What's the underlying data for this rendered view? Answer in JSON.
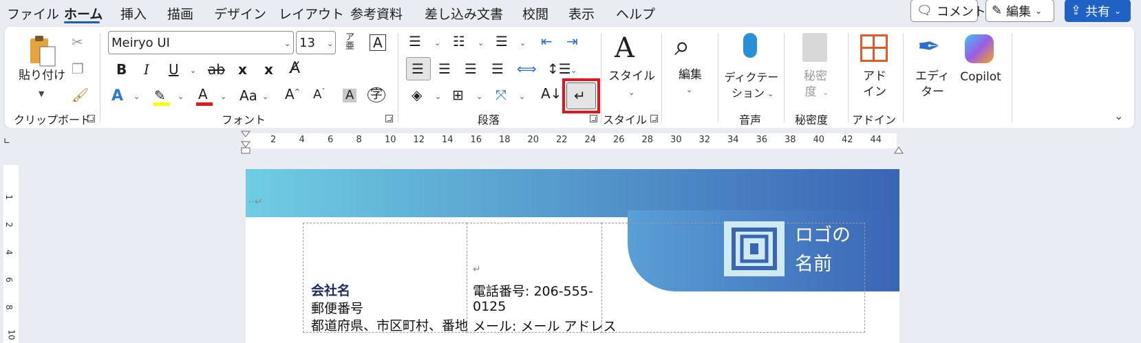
{
  "menu": {
    "file": "ファイル",
    "home": "ホーム",
    "insert": "挿入",
    "draw": "描画",
    "design": "デザイン",
    "layout": "レイアウト",
    "references": "参考資料",
    "mailings": "差し込み文書",
    "review": "校閲",
    "view": "表示",
    "help": "ヘルプ"
  },
  "top_buttons": {
    "comment": "コメント",
    "edit": "編集",
    "share": "共有"
  },
  "ribbon": {
    "clipboard": {
      "paste": "貼り付け",
      "group": "クリップボード"
    },
    "font": {
      "name": "Meiryo UI",
      "size": "13",
      "group": "フォント",
      "bold": "B",
      "italic": "I",
      "underline": "U",
      "strike": "ab",
      "sub": "x",
      "sup": "x",
      "case": "Aa"
    },
    "paragraph": {
      "group": "段落"
    },
    "styles": {
      "label": "スタイル",
      "group": "スタイル"
    },
    "editing": {
      "label": "編集"
    },
    "voice": {
      "label1": "ディクテー",
      "label2": "ション",
      "group": "音声"
    },
    "sensitivity": {
      "label1": "秘密",
      "label2": "度",
      "group": "秘密度"
    },
    "addins": {
      "label1": "アド",
      "label2": "イン",
      "group": "アドイン"
    },
    "editor": {
      "label1": "エディ",
      "label2": "ター"
    },
    "copilot": {
      "label": "Copilot"
    }
  },
  "ruler": {
    "numbers": [
      "2",
      "4",
      "6",
      "8",
      "10",
      "12",
      "14",
      "16",
      "18",
      "20",
      "22",
      "24",
      "26",
      "28",
      "30",
      "32",
      "34",
      "36",
      "38",
      "40",
      "42",
      "44"
    ],
    "vnumbers": [
      "1",
      "2",
      "4",
      "6",
      "8",
      "10"
    ]
  },
  "document": {
    "company_name": "会社名",
    "postal_code": "郵便番号",
    "address": "都道府県、市区町村、番地",
    "phone": "電話番号: 206-555-",
    "phone2": "0125",
    "email": "メール: メール アドレス",
    "logo_line1": "ロゴの",
    "logo_line2": "名前",
    "return_mark": "↵"
  },
  "colors": {
    "accent": "#1f62c4",
    "header_start": "#6fcde3",
    "header_end": "#3a65b5",
    "highlight": "#e3141c"
  }
}
